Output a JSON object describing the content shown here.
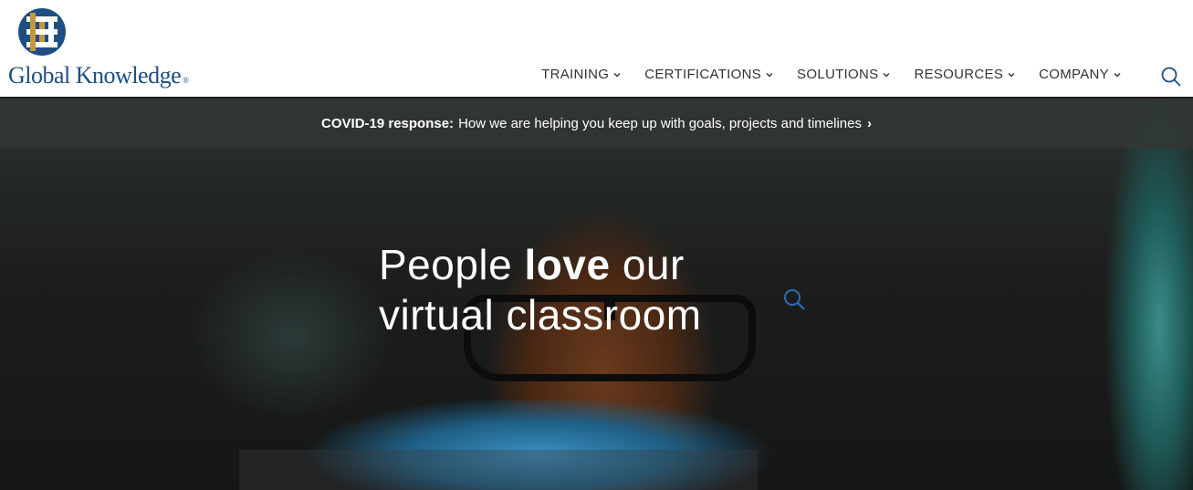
{
  "logo": {
    "text": "Global Knowledge",
    "reg": "®"
  },
  "nav": {
    "items": [
      {
        "label": "TRAINING"
      },
      {
        "label": "CERTIFICATIONS"
      },
      {
        "label": "SOLUTIONS"
      },
      {
        "label": "RESOURCES"
      },
      {
        "label": "COMPANY"
      }
    ]
  },
  "banner": {
    "bold": "COVID-19 response:",
    "text": "How we are helping you keep up with goals, projects and timelines",
    "arrow": "›"
  },
  "hero": {
    "line1_pre": "People ",
    "line1_strong": "love",
    "line1_post": " our",
    "line2": "virtual classroom"
  },
  "colors": {
    "brand": "#1f4e82",
    "gold": "#c8963e",
    "nav_text": "#333333"
  },
  "icons": {
    "search": "search-icon",
    "chevron": "chevron-down-icon"
  }
}
